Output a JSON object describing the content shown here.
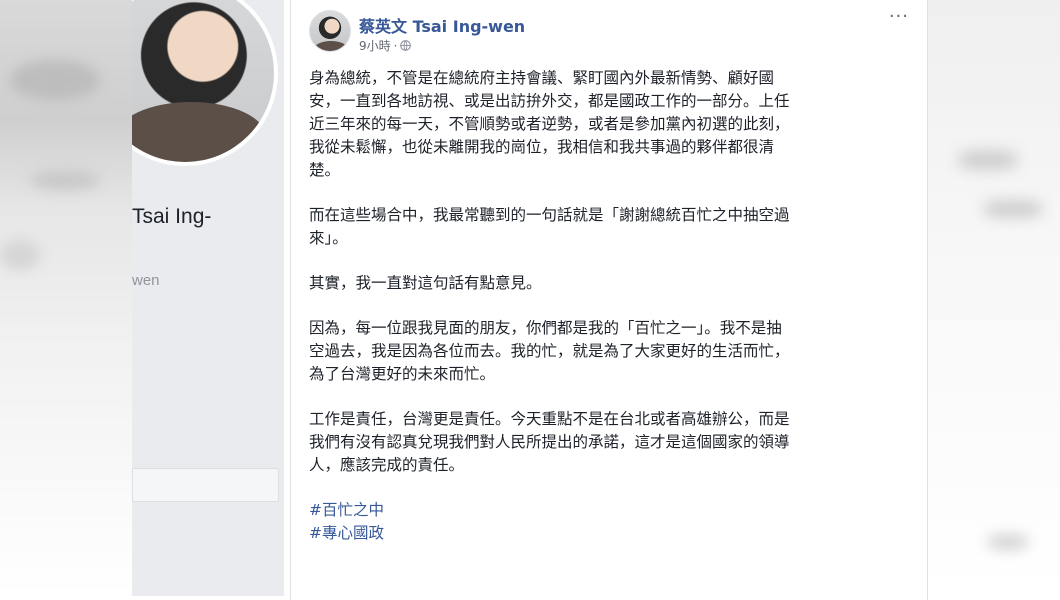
{
  "profile": {
    "name_fragment": "Tsai Ing-",
    "handle_fragment": "wen"
  },
  "post": {
    "author": "蔡英文 Tsai Ing-wen",
    "timestamp": "9小時",
    "separator": "·",
    "more": "···",
    "paragraphs": [
      "身為總統，不管是在總統府主持會議、緊盯國內外最新情勢、顧好國\n安，一直到各地訪視、或是出訪拚外交，都是國政工作的一部分。上任\n近三年來的每一天，不管順勢或者逆勢，或者是參加黨內初選的此刻，\n我從未鬆懈，也從未離開我的崗位，我相信和我共事過的夥伴都很清\n楚。",
      "而在這些場合中，我最常聽到的一句話就是「謝謝總統百忙之中抽空過\n來」。",
      "其實，我一直對這句話有點意見。",
      "因為，每一位跟我見面的朋友，你們都是我的「百忙之一」。我不是抽\n空過去，我是因為各位而去。我的忙，就是為了大家更好的生活而忙，\n為了台灣更好的未來而忙。",
      "工作是責任，台灣更是責任。今天重點不是在台北或者高雄辦公，而是\n我們有沒有認真兌現我們對人民所提出的承諾，這才是這個國家的領導\n人，應該完成的責任。"
    ],
    "hashtags": [
      "#百忙之中",
      "#專心國政"
    ]
  },
  "colors": {
    "link": "#365899",
    "author": "#385898",
    "text": "#1d2129",
    "meta": "#616770"
  }
}
